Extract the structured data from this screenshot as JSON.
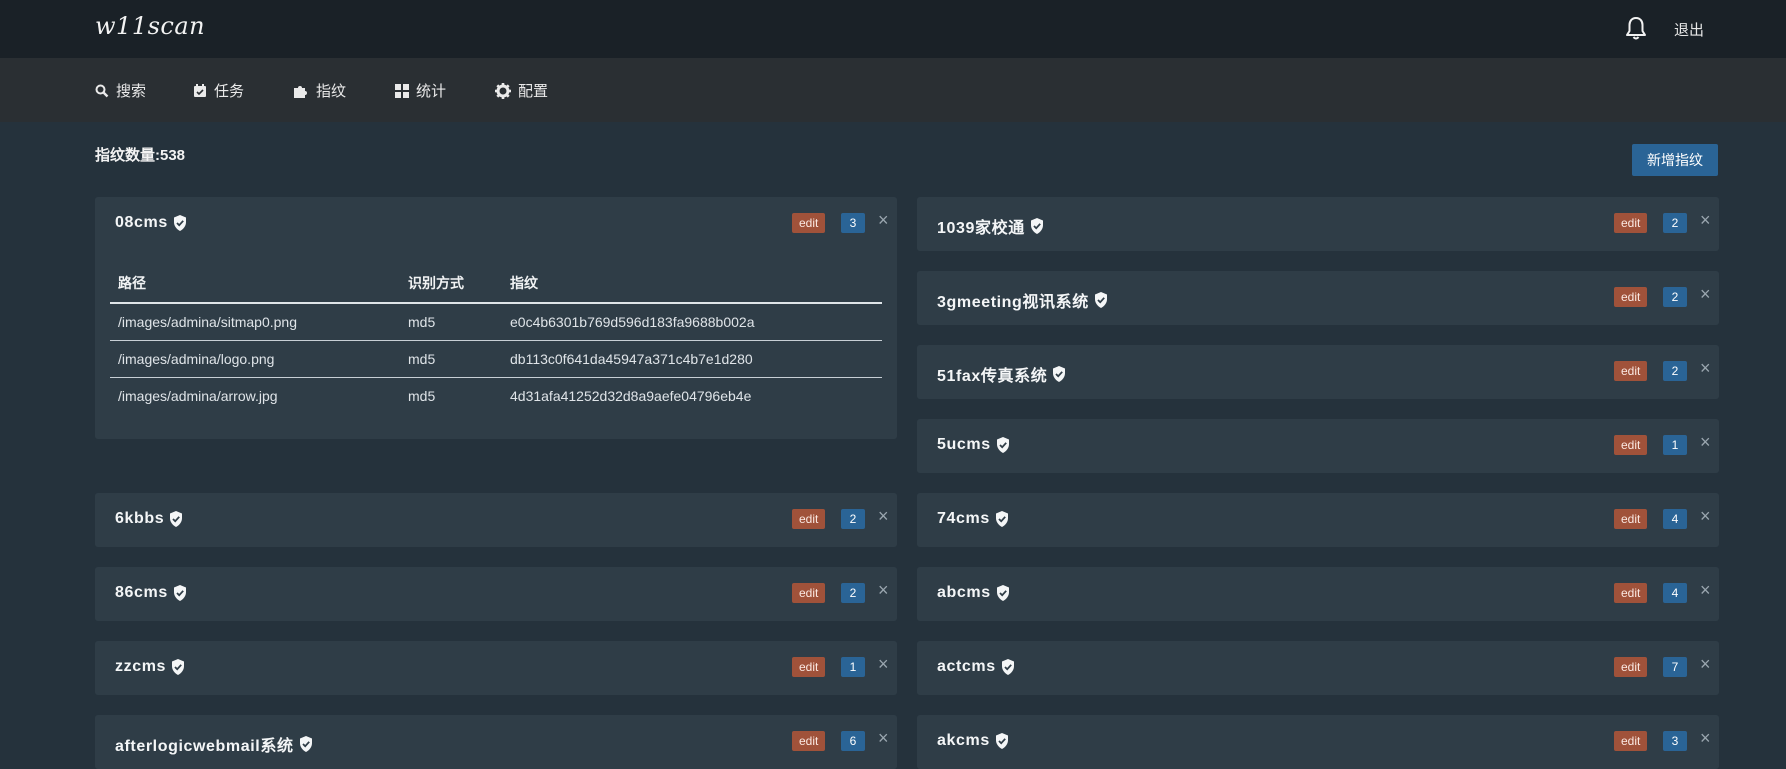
{
  "app": {
    "logo": "w11scan",
    "logout": "退出"
  },
  "nav": [
    {
      "label": "搜索",
      "icon": "search-icon"
    },
    {
      "label": "任务",
      "icon": "calendar-icon"
    },
    {
      "label": "指纹",
      "icon": "puzzle-icon"
    },
    {
      "label": "统计",
      "icon": "dashboard-icon"
    },
    {
      "label": "配置",
      "icon": "gear-icon"
    }
  ],
  "page": {
    "count_label": "指纹数量:538",
    "add_button": "新增指纹"
  },
  "colors": {
    "edit_badge": "#a0523a",
    "count_badge": "#2a6496",
    "card_bg": "#2f3d47"
  },
  "expanded": {
    "columns": [
      "路径",
      "识别方式",
      "指纹"
    ],
    "rows": [
      [
        "/images/admina/sitmap0.png",
        "md5",
        "e0c4b6301b769d596d183fa9688b002a"
      ],
      [
        "/images/admina/logo.png",
        "md5",
        "db113c0f641da45947a371c4b7e1d280"
      ],
      [
        "/images/admina/arrow.jpg",
        "md5",
        "4d31afa41252d32d8a9aefe04796eb4e"
      ]
    ]
  },
  "cards": [
    {
      "name": "08cms",
      "edit": "edit",
      "count": "3"
    },
    {
      "name": "1039家校通",
      "edit": "edit",
      "count": "2"
    },
    {
      "name": "3gmeeting视讯系统",
      "edit": "edit",
      "count": "2"
    },
    {
      "name": "51fax传真系统",
      "edit": "edit",
      "count": "2"
    },
    {
      "name": "5ucms",
      "edit": "edit",
      "count": "1"
    },
    {
      "name": "6kbbs",
      "edit": "edit",
      "count": "2"
    },
    {
      "name": "74cms",
      "edit": "edit",
      "count": "4"
    },
    {
      "name": "86cms",
      "edit": "edit",
      "count": "2"
    },
    {
      "name": "abcms",
      "edit": "edit",
      "count": "4"
    },
    {
      "name": "zzcms",
      "edit": "edit",
      "count": "1"
    },
    {
      "name": "actcms",
      "edit": "edit",
      "count": "7"
    },
    {
      "name": "afterlogicwebmail系统",
      "edit": "edit",
      "count": "6"
    },
    {
      "name": "akcms",
      "edit": "edit",
      "count": "3"
    }
  ]
}
